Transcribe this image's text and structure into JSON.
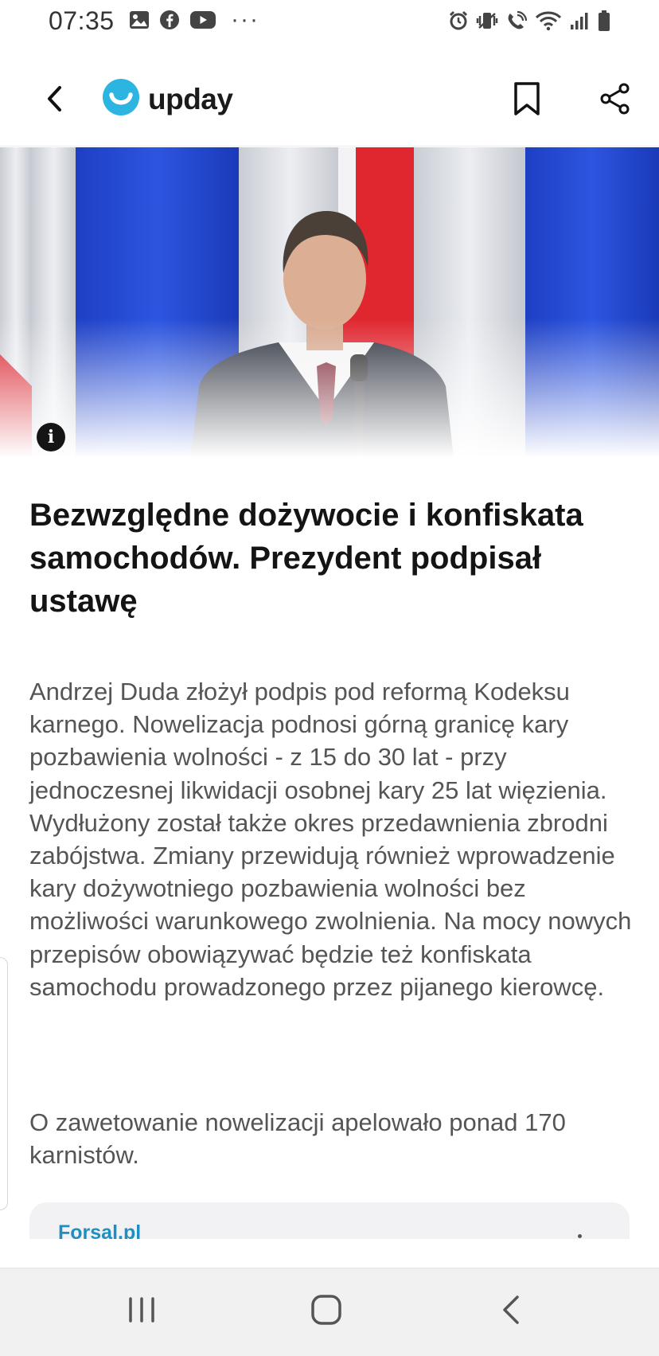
{
  "status_bar": {
    "time": "07:35",
    "left_icons": [
      "gallery-icon",
      "facebook-icon",
      "youtube-icon"
    ],
    "overflow": "···",
    "right_icons": [
      "alarm-icon",
      "vibrate-icon",
      "wifi-calling-icon",
      "wifi-icon",
      "signal-icon",
      "battery-icon"
    ]
  },
  "app_bar": {
    "logo_text": "upday",
    "logo_color": "#2bb5e0",
    "icons": [
      "back-arrow-icon",
      "bookmark-icon",
      "share-icon"
    ]
  },
  "hero": {
    "info_symbol": "i"
  },
  "article": {
    "headline": "Bezwzględne dożywocie i konfiskata samochodów. Prezydent podpisał ustawę",
    "paragraphs": [
      "Andrzej Duda złożył podpis pod reformą Kodeksu karnego. Nowelizacja podnosi górną granicę kary pozbawienia wolności - z 15 do 30 lat - przy jednoczesnej likwidacji osobnej kary 25 lat więzienia. Wydłużony został także okres przedawnienia zbrodni zabójstwa. Zmiany przewidują również wprowadzenie kary dożywotniego pozbawienia wolności bez możliwości warunkowego zwolnienia. Na mocy nowych przepisów obowiązywać będzie też konfiskata samochodu prowadzonego przez pijanego kierowcę.",
      "O zawetowanie nowelizacji apelowało ponad 170 karnistów."
    ]
  },
  "source_card": {
    "label": "Forsal.pl"
  },
  "nav_bar": {
    "icons": [
      "recent-apps-icon",
      "home-icon",
      "back-icon"
    ]
  }
}
